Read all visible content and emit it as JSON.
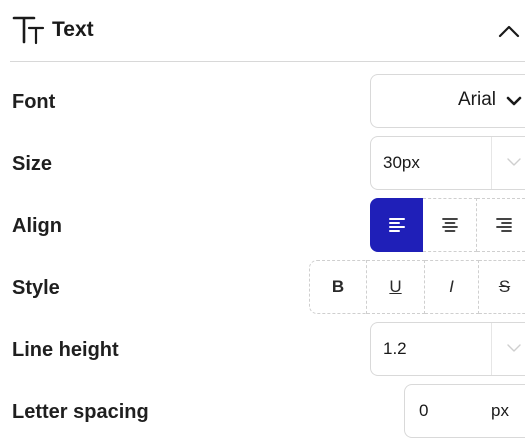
{
  "panel": {
    "title": "Text",
    "icon": "text-format-icon",
    "collapse_icon": "chevron-up-icon"
  },
  "rows": {
    "font": {
      "label": "Font",
      "value": "Arial"
    },
    "size": {
      "label": "Size",
      "value": "30px"
    },
    "align": {
      "label": "Align",
      "options": [
        "left",
        "center",
        "right"
      ],
      "selected": "left"
    },
    "style": {
      "label": "Style",
      "buttons": [
        "B",
        "U",
        "I",
        "S"
      ]
    },
    "line_height": {
      "label": "Line height",
      "value": "1.2"
    },
    "letter_spacing": {
      "label": "Letter spacing",
      "value": "0",
      "unit": "px"
    }
  },
  "colors": {
    "accent": "#1f1fb8",
    "border": "#d9d9d9",
    "text": "#1f1f1f"
  }
}
